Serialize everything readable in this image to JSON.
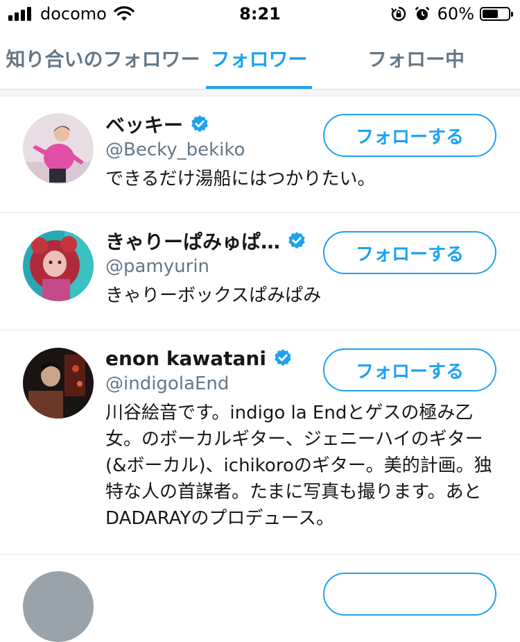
{
  "status_bar": {
    "carrier": "docomo",
    "time": "8:21",
    "battery_pct": "60%",
    "battery_level": 0.6,
    "icons": [
      "signal-icon",
      "wifi-icon",
      "rotation-lock-icon",
      "alarm-icon",
      "battery-icon"
    ]
  },
  "tabs": [
    {
      "label": "知り合いのフォロワー",
      "active": false
    },
    {
      "label": "フォロワー",
      "active": true
    },
    {
      "label": "フォロー中",
      "active": false
    }
  ],
  "colors": {
    "accent": "#1da1f2",
    "text": "#14171a",
    "secondary": "#657786",
    "divider": "#e1e8ed"
  },
  "users": [
    {
      "name": "ベッキー",
      "handle": "@Becky_bekiko",
      "bio": "できるだけ湯船にはつかりたい。",
      "verified": true,
      "follow_label": "フォローする"
    },
    {
      "name": "きゃりーぱみゅぱ…",
      "handle": "@pamyurin",
      "bio": "きゃりーボックスぱみぱみ",
      "verified": true,
      "follow_label": "フォローする"
    },
    {
      "name": "enon kawatani",
      "handle": "@indigolaEnd",
      "bio": "川谷絵音です。indigo la Endとゲスの極み乙女。のボーカルギター、ジェニーハイのギター(&ボーカル)、ichikoroのギター。美的計画。独特な人の首謀者。たまに写真も撮ります。あとDADARAYのプロデュース。",
      "verified": true,
      "follow_label": "フォローする"
    }
  ]
}
